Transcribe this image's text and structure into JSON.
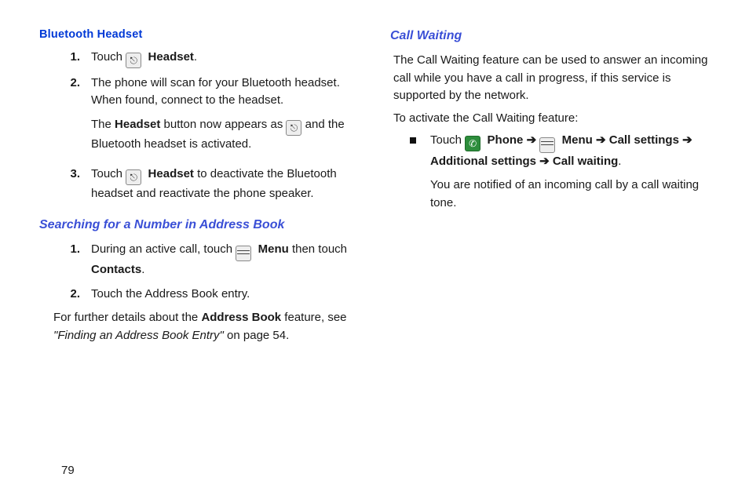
{
  "left": {
    "bluetooth_heading": "Bluetooth Headset",
    "step1": {
      "num": "1.",
      "touch": "Touch ",
      "headset": "Headset",
      "dot": "."
    },
    "step2": {
      "num": "2.",
      "para1": "The phone will scan for your Bluetooth headset. When found, connect to the headset.",
      "para2a": "The ",
      "para2b": "Headset",
      "para2c": " button now appears as ",
      "para2d": " and the Bluetooth headset is activated."
    },
    "step3": {
      "num": "3.",
      "touch": "Touch ",
      "headset": "Headset",
      "tail": " to deactivate the Bluetooth headset and reactivate the phone speaker."
    },
    "search_heading": "Searching for a Number in Address Book",
    "s_step1": {
      "num": "1.",
      "a": "During an active call, touch ",
      "menu": "Menu",
      "b": " then touch ",
      "contacts": "Contacts",
      "dot": "."
    },
    "s_step2": {
      "num": "2.",
      "text": "Touch the Address Book entry."
    },
    "further_a": "For further details about the ",
    "further_b": "Address Book",
    "further_c": " feature, see ",
    "further_quote": "\"Finding an Address Book Entry\"",
    "further_d": " on page 54."
  },
  "right": {
    "cw_heading": "Call Waiting",
    "cw_para": "The Call Waiting feature can be used to answer an incoming call while you have a call in progress, if this service is supported by the network.",
    "cw_activate": "To activate the Call Waiting feature:",
    "bullet": {
      "touch": "Touch ",
      "phone": "Phone",
      "arrow": " ➔ ",
      "menu": "Menu",
      "call_settings": "Call settings",
      "additional": "Additional settings",
      "call_waiting": "Call waiting",
      "dot": ".",
      "notified": "You are notified of an incoming call by a call waiting tone."
    }
  },
  "page": "79"
}
